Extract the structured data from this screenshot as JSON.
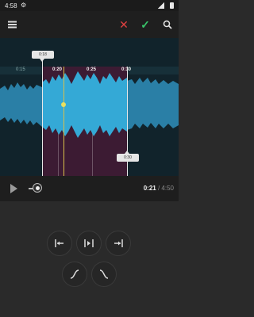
{
  "status_bar": {
    "time": "4:58",
    "icons": [
      "gear-icon",
      "signal-icon",
      "battery-icon"
    ]
  },
  "toolbar": {
    "icons": [
      "menu-icon",
      "close-icon",
      "check-icon",
      "search-zoom-icon"
    ],
    "accent_cancel": "#e04040",
    "accent_confirm": "#39c46a"
  },
  "waveform": {
    "ruler_ticks": [
      "0:15",
      "0:20",
      "0:25",
      "0:30"
    ],
    "selection_start_label": "0:18",
    "selection_end_label": "0:30",
    "colors": {
      "wave": "#2a97c2",
      "selected_wave": "#34a9d6",
      "selection_bg": "#3c1b33",
      "playhead": "#d9c04a"
    }
  },
  "player": {
    "current_time": "0:21",
    "separator": " / ",
    "total_time": "4:50"
  },
  "controls": {
    "buttons": [
      "jump-to-start-icon",
      "center-playhead-icon",
      "jump-to-end-icon",
      "fade-in-icon",
      "fade-out-icon"
    ]
  }
}
